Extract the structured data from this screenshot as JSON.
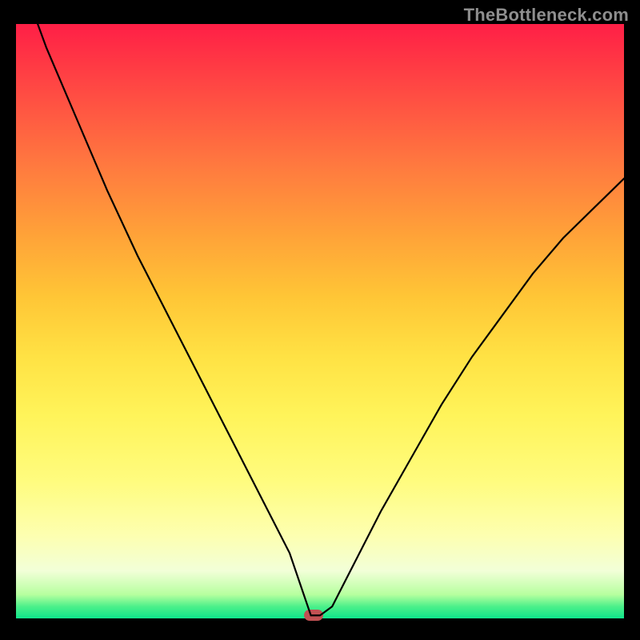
{
  "watermark": "TheBottleneck.com",
  "colors": {
    "curve_stroke": "#000000",
    "marker_fill": "#c15153",
    "border": "#000000"
  },
  "chart_data": {
    "type": "line",
    "title": "",
    "xlabel": "",
    "ylabel": "",
    "xlim": [
      0,
      100
    ],
    "ylim": [
      0,
      100
    ],
    "grid": false,
    "legend": false,
    "description": "Bottleneck curve on red-to-green vertical gradient; minimum marks optimal balance point",
    "series": [
      {
        "name": "bottleneck_percent",
        "x": [
          0,
          5,
          10,
          15,
          20,
          25,
          30,
          35,
          40,
          45,
          47,
          48.5,
          50,
          52,
          55,
          60,
          65,
          70,
          75,
          80,
          85,
          90,
          95,
          100
        ],
        "y": [
          110,
          96,
          84,
          72,
          61,
          51,
          41,
          31,
          21,
          11,
          5,
          0.5,
          0.5,
          2,
          8,
          18,
          27,
          36,
          44,
          51,
          58,
          64,
          69,
          74
        ]
      }
    ],
    "marker": {
      "x": 49,
      "y": 0.5
    },
    "background_gradient": {
      "direction": "vertical",
      "stops": [
        {
          "pos": 0,
          "color": "#ff1f46"
        },
        {
          "pos": 24,
          "color": "#ff7a3f"
        },
        {
          "pos": 46,
          "color": "#ffc636"
        },
        {
          "pos": 66,
          "color": "#fff45a"
        },
        {
          "pos": 86,
          "color": "#fdffb0"
        },
        {
          "pos": 96,
          "color": "#b6ff9f"
        },
        {
          "pos": 100,
          "color": "#0fe58b"
        }
      ]
    }
  }
}
